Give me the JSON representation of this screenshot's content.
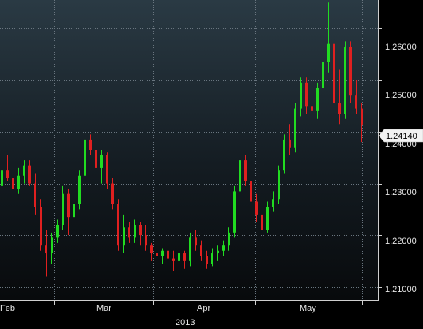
{
  "chart_data": {
    "type": "candlestick",
    "title": "",
    "xlabel": "",
    "ylabel": "",
    "year_label": "2013",
    "month_labels": [
      "Feb",
      "Mar",
      "Apr",
      "May"
    ],
    "y_ticks": [
      1.21,
      1.22,
      1.23,
      1.24,
      1.25,
      1.26
    ],
    "y_tick_labels": [
      "1.21000",
      "1.22000",
      "1.23000",
      "1.24000",
      "1.25000",
      "1.26000"
    ],
    "ylim": [
      1.2075,
      1.2655
    ],
    "grid": true,
    "last_price": 1.2414,
    "last_price_label": "1.24140",
    "colors": {
      "up": "#21dc21",
      "down": "#e02020",
      "background_top": "#2a3a44",
      "background_bottom": "#080a0c",
      "grid": "#6a7680"
    },
    "candles": [
      [
        1.2295,
        1.2345,
        1.2285,
        1.2325
      ],
      [
        1.2325,
        1.2355,
        1.2305,
        1.231
      ],
      [
        1.231,
        1.2335,
        1.2275,
        1.229
      ],
      [
        1.229,
        1.233,
        1.228,
        1.2315
      ],
      [
        1.2315,
        1.2345,
        1.23,
        1.2335
      ],
      [
        1.2335,
        1.2345,
        1.2295,
        1.23
      ],
      [
        1.23,
        1.232,
        1.224,
        1.2255
      ],
      [
        1.2255,
        1.227,
        1.217,
        1.218
      ],
      [
        1.218,
        1.221,
        1.212,
        1.2165
      ],
      [
        1.2165,
        1.2205,
        1.2145,
        1.2195
      ],
      [
        1.2195,
        1.223,
        1.2185,
        1.222
      ],
      [
        1.222,
        1.2295,
        1.221,
        1.228
      ],
      [
        1.228,
        1.229,
        1.22,
        1.2235
      ],
      [
        1.2235,
        1.2275,
        1.2225,
        1.226
      ],
      [
        1.226,
        1.2325,
        1.225,
        1.2315
      ],
      [
        1.2315,
        1.2395,
        1.2305,
        1.2385
      ],
      [
        1.2385,
        1.2395,
        1.2355,
        1.2365
      ],
      [
        1.2365,
        1.238,
        1.2315,
        1.233
      ],
      [
        1.233,
        1.2365,
        1.23,
        1.2355
      ],
      [
        1.2355,
        1.236,
        1.229,
        1.23
      ],
      [
        1.23,
        1.231,
        1.225,
        1.226
      ],
      [
        1.226,
        1.227,
        1.217,
        1.218
      ],
      [
        1.218,
        1.224,
        1.2165,
        1.2215
      ],
      [
        1.2215,
        1.2225,
        1.2185,
        1.2195
      ],
      [
        1.2195,
        1.223,
        1.2185,
        1.222
      ],
      [
        1.222,
        1.2225,
        1.218,
        1.22
      ],
      [
        1.22,
        1.222,
        1.217,
        1.218
      ],
      [
        1.218,
        1.2185,
        1.215,
        1.2165
      ],
      [
        1.2165,
        1.2175,
        1.215,
        1.216
      ],
      [
        1.216,
        1.2175,
        1.2145,
        1.217
      ],
      [
        1.217,
        1.218,
        1.214,
        1.2155
      ],
      [
        1.2155,
        1.217,
        1.213,
        1.215
      ],
      [
        1.215,
        1.2175,
        1.214,
        1.2165
      ],
      [
        1.2165,
        1.217,
        1.2135,
        1.215
      ],
      [
        1.215,
        1.2205,
        1.214,
        1.2195
      ],
      [
        1.2195,
        1.221,
        1.217,
        1.218
      ],
      [
        1.218,
        1.219,
        1.215,
        1.216
      ],
      [
        1.216,
        1.217,
        1.2135,
        1.2145
      ],
      [
        1.2145,
        1.2175,
        1.214,
        1.2165
      ],
      [
        1.2165,
        1.218,
        1.215,
        1.217
      ],
      [
        1.217,
        1.219,
        1.216,
        1.218
      ],
      [
        1.218,
        1.2215,
        1.217,
        1.2205
      ],
      [
        1.2205,
        1.2295,
        1.2195,
        1.2285
      ],
      [
        1.2285,
        1.2355,
        1.2275,
        1.2345
      ],
      [
        1.2345,
        1.2355,
        1.2295,
        1.2305
      ],
      [
        1.2305,
        1.232,
        1.2255,
        1.2265
      ],
      [
        1.2265,
        1.228,
        1.2225,
        1.224
      ],
      [
        1.224,
        1.225,
        1.2195,
        1.221
      ],
      [
        1.221,
        1.2265,
        1.2205,
        1.2255
      ],
      [
        1.2255,
        1.2285,
        1.2245,
        1.227
      ],
      [
        1.227,
        1.2335,
        1.226,
        1.2325
      ],
      [
        1.2325,
        1.2395,
        1.232,
        1.2385
      ],
      [
        1.2385,
        1.2415,
        1.2355,
        1.237
      ],
      [
        1.237,
        1.2455,
        1.236,
        1.2445
      ],
      [
        1.2445,
        1.2505,
        1.243,
        1.2495
      ],
      [
        1.2495,
        1.2505,
        1.2435,
        1.245
      ],
      [
        1.245,
        1.2475,
        1.2395,
        1.244
      ],
      [
        1.244,
        1.2495,
        1.2425,
        1.2485
      ],
      [
        1.2485,
        1.2545,
        1.2475,
        1.2535
      ],
      [
        1.2535,
        1.265,
        1.2515,
        1.257
      ],
      [
        1.257,
        1.2595,
        1.2445,
        1.2455
      ],
      [
        1.2455,
        1.252,
        1.2415,
        1.2435
      ],
      [
        1.2435,
        1.2575,
        1.2425,
        1.2565
      ],
      [
        1.2565,
        1.2575,
        1.2455,
        1.247
      ],
      [
        1.247,
        1.25,
        1.2435,
        1.2445
      ],
      [
        1.2445,
        1.2455,
        1.238,
        1.2414
      ]
    ]
  }
}
